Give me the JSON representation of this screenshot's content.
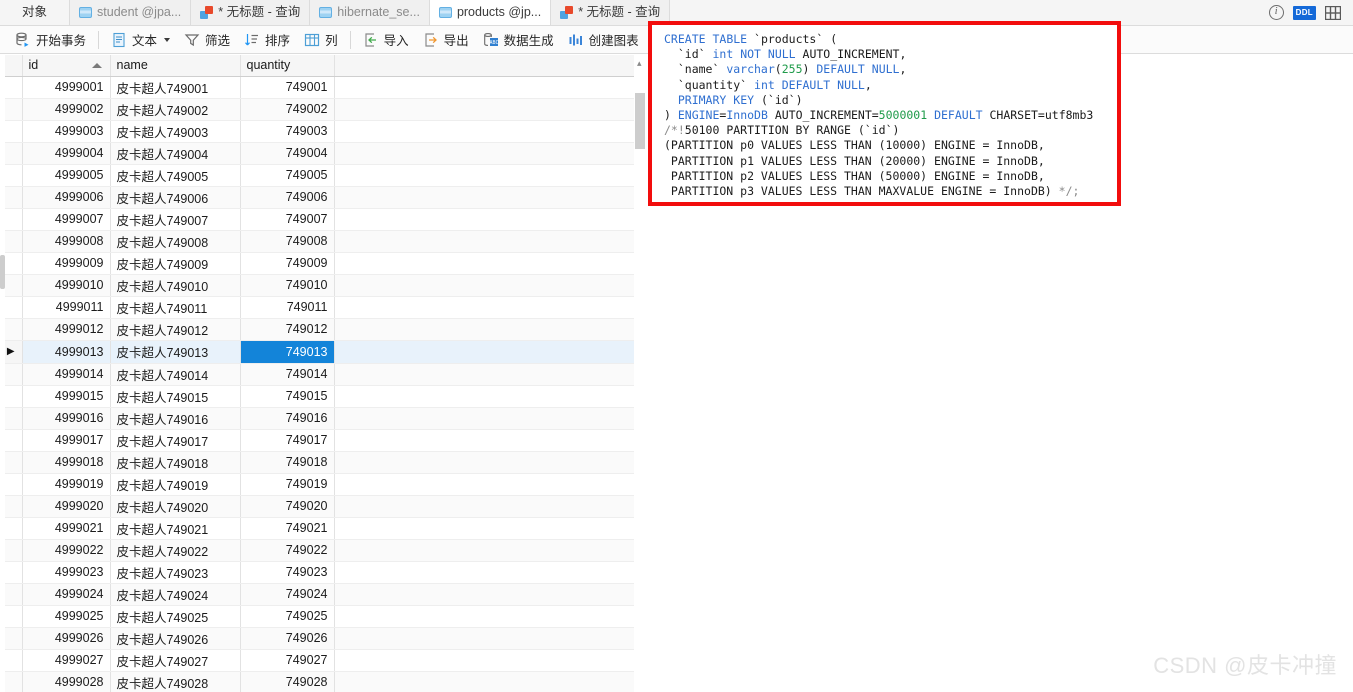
{
  "tabbar": {
    "first_label": "对象",
    "tabs": [
      {
        "label": "student @jpa...",
        "icon": "database-icon",
        "active": false
      },
      {
        "label": "* 无标题 - 查询",
        "icon": "query-icon",
        "active": false
      },
      {
        "label": "hibernate_se...",
        "icon": "database-icon",
        "active": false
      },
      {
        "label": "products @jp...",
        "icon": "database-icon",
        "active": true
      },
      {
        "label": "* 无标题 - 查询",
        "icon": "query-icon",
        "active": false
      }
    ],
    "right_icons": [
      {
        "name": "info-icon",
        "glyph": "i"
      },
      {
        "name": "ddl-badge-icon",
        "glyph": "DDL"
      },
      {
        "name": "grid-layout-icon",
        "glyph": "grid"
      }
    ]
  },
  "toolbar": {
    "buttons": [
      {
        "label": "开始事务",
        "icon": "begin-transaction-icon",
        "caret": false
      },
      {
        "label": "文本",
        "icon": "text-icon",
        "caret": true
      },
      {
        "label": "筛选",
        "icon": "filter-icon",
        "caret": false
      },
      {
        "label": "排序",
        "icon": "sort-icon",
        "caret": false
      },
      {
        "label": "列",
        "icon": "columns-icon",
        "caret": false
      },
      {
        "label": "导入",
        "icon": "import-icon",
        "caret": false
      },
      {
        "label": "导出",
        "icon": "export-icon",
        "caret": false
      },
      {
        "label": "数据生成",
        "icon": "data-generation-icon",
        "caret": false
      },
      {
        "label": "创建图表",
        "icon": "create-chart-icon",
        "caret": false
      }
    ]
  },
  "grid": {
    "columns": [
      {
        "key": "id",
        "label": "id",
        "sorted": "asc",
        "highlighted": false
      },
      {
        "key": "name",
        "label": "name",
        "sorted": "",
        "highlighted": false
      },
      {
        "key": "quantity",
        "label": "quantity",
        "sorted": "",
        "highlighted": true
      }
    ],
    "selected_row_index": 12,
    "selected_column": "quantity",
    "rows": [
      {
        "id": "4999001",
        "name": "皮卡超人749001",
        "quantity": "749001"
      },
      {
        "id": "4999002",
        "name": "皮卡超人749002",
        "quantity": "749002"
      },
      {
        "id": "4999003",
        "name": "皮卡超人749003",
        "quantity": "749003"
      },
      {
        "id": "4999004",
        "name": "皮卡超人749004",
        "quantity": "749004"
      },
      {
        "id": "4999005",
        "name": "皮卡超人749005",
        "quantity": "749005"
      },
      {
        "id": "4999006",
        "name": "皮卡超人749006",
        "quantity": "749006"
      },
      {
        "id": "4999007",
        "name": "皮卡超人749007",
        "quantity": "749007"
      },
      {
        "id": "4999008",
        "name": "皮卡超人749008",
        "quantity": "749008"
      },
      {
        "id": "4999009",
        "name": "皮卡超人749009",
        "quantity": "749009"
      },
      {
        "id": "4999010",
        "name": "皮卡超人749010",
        "quantity": "749010"
      },
      {
        "id": "4999011",
        "name": "皮卡超人749011",
        "quantity": "749011"
      },
      {
        "id": "4999012",
        "name": "皮卡超人749012",
        "quantity": "749012"
      },
      {
        "id": "4999013",
        "name": "皮卡超人749013",
        "quantity": "749013"
      },
      {
        "id": "4999014",
        "name": "皮卡超人749014",
        "quantity": "749014"
      },
      {
        "id": "4999015",
        "name": "皮卡超人749015",
        "quantity": "749015"
      },
      {
        "id": "4999016",
        "name": "皮卡超人749016",
        "quantity": "749016"
      },
      {
        "id": "4999017",
        "name": "皮卡超人749017",
        "quantity": "749017"
      },
      {
        "id": "4999018",
        "name": "皮卡超人749018",
        "quantity": "749018"
      },
      {
        "id": "4999019",
        "name": "皮卡超人749019",
        "quantity": "749019"
      },
      {
        "id": "4999020",
        "name": "皮卡超人749020",
        "quantity": "749020"
      },
      {
        "id": "4999021",
        "name": "皮卡超人749021",
        "quantity": "749021"
      },
      {
        "id": "4999022",
        "name": "皮卡超人749022",
        "quantity": "749022"
      },
      {
        "id": "4999023",
        "name": "皮卡超人749023",
        "quantity": "749023"
      },
      {
        "id": "4999024",
        "name": "皮卡超人749024",
        "quantity": "749024"
      },
      {
        "id": "4999025",
        "name": "皮卡超人749025",
        "quantity": "749025"
      },
      {
        "id": "4999026",
        "name": "皮卡超人749026",
        "quantity": "749026"
      },
      {
        "id": "4999027",
        "name": "皮卡超人749027",
        "quantity": "749027"
      },
      {
        "id": "4999028",
        "name": "皮卡超人749028",
        "quantity": "749028"
      }
    ]
  },
  "sql": {
    "lines": [
      [
        {
          "t": "CREATE",
          "c": "kw"
        },
        {
          "t": " ",
          "c": "pl"
        },
        {
          "t": "TABLE",
          "c": "kw"
        },
        {
          "t": " `products` (",
          "c": "pl"
        }
      ],
      [
        {
          "t": "  `id` ",
          "c": "pl"
        },
        {
          "t": "int",
          "c": "kw"
        },
        {
          "t": " ",
          "c": "pl"
        },
        {
          "t": "NOT",
          "c": "kw"
        },
        {
          "t": " ",
          "c": "pl"
        },
        {
          "t": "NULL",
          "c": "kw"
        },
        {
          "t": " AUTO_INCREMENT,",
          "c": "pl"
        }
      ],
      [
        {
          "t": "  `name` ",
          "c": "pl"
        },
        {
          "t": "varchar",
          "c": "kw"
        },
        {
          "t": "(",
          "c": "pl"
        },
        {
          "t": "255",
          "c": "num"
        },
        {
          "t": ") ",
          "c": "pl"
        },
        {
          "t": "DEFAULT",
          "c": "kw"
        },
        {
          "t": " ",
          "c": "pl"
        },
        {
          "t": "NULL",
          "c": "kw"
        },
        {
          "t": ",",
          "c": "pl"
        }
      ],
      [
        {
          "t": "  `quantity` ",
          "c": "pl"
        },
        {
          "t": "int",
          "c": "kw"
        },
        {
          "t": " ",
          "c": "pl"
        },
        {
          "t": "DEFAULT",
          "c": "kw"
        },
        {
          "t": " ",
          "c": "pl"
        },
        {
          "t": "NULL",
          "c": "kw"
        },
        {
          "t": ",",
          "c": "pl"
        }
      ],
      [
        {
          "t": "  ",
          "c": "pl"
        },
        {
          "t": "PRIMARY",
          "c": "kw"
        },
        {
          "t": " ",
          "c": "pl"
        },
        {
          "t": "KEY",
          "c": "kw"
        },
        {
          "t": " (`id`)",
          "c": "pl"
        }
      ],
      [
        {
          "t": ") ",
          "c": "pl"
        },
        {
          "t": "ENGINE",
          "c": "kw"
        },
        {
          "t": "=",
          "c": "pl"
        },
        {
          "t": "InnoDB",
          "c": "kw"
        },
        {
          "t": " AUTO_INCREMENT=",
          "c": "pl"
        },
        {
          "t": "5000001",
          "c": "num"
        },
        {
          "t": " ",
          "c": "pl"
        },
        {
          "t": "DEFAULT",
          "c": "kw"
        },
        {
          "t": " CHARSET=utf8mb3",
          "c": "pl"
        }
      ],
      [
        {
          "t": "/*!",
          "c": "cmt"
        },
        {
          "t": "50100 PARTITION BY RANGE (`id`)",
          "c": "pl"
        }
      ],
      [
        {
          "t": "(PARTITION p0 VALUES LESS THAN (10000) ENGINE = InnoDB,",
          "c": "pl"
        }
      ],
      [
        {
          "t": " PARTITION p1 VALUES LESS THAN (20000) ENGINE = InnoDB,",
          "c": "pl"
        }
      ],
      [
        {
          "t": " PARTITION p2 VALUES LESS THAN (50000) ENGINE = InnoDB,",
          "c": "pl"
        }
      ],
      [
        {
          "t": " PARTITION p3 VALUES LESS THAN MAXVALUE ENGINE = InnoDB) ",
          "c": "pl"
        },
        {
          "t": "*/;",
          "c": "cmt"
        }
      ]
    ],
    "plain_text": "CREATE TABLE `products` (\n  `id` int NOT NULL AUTO_INCREMENT,\n  `name` varchar(255) DEFAULT NULL,\n  `quantity` int DEFAULT NULL,\n  PRIMARY KEY (`id`)\n) ENGINE=InnoDB AUTO_INCREMENT=5000001 DEFAULT CHARSET=utf8mb3\n/*!50100 PARTITION BY RANGE (`id`)\n(PARTITION p0 VALUES LESS THAN (10000) ENGINE = InnoDB,\n PARTITION p1 VALUES LESS THAN (20000) ENGINE = InnoDB,\n PARTITION p2 VALUES LESS THAN (50000) ENGINE = InnoDB,\n PARTITION p3 VALUES LESS THAN MAXVALUE ENGINE = InnoDB) */;",
    "highlight_color": "#f20d0d"
  },
  "watermark": {
    "text": "CSDN @皮卡冲撞"
  },
  "colors": {
    "accent_blue": "#1384d9",
    "header_highlight": "#d8ebfa",
    "selection_row": "#e8f2fb",
    "annotation_red": "#f20d0d",
    "keyword_blue": "#2f6fd0",
    "number_green": "#1f9b4a"
  }
}
